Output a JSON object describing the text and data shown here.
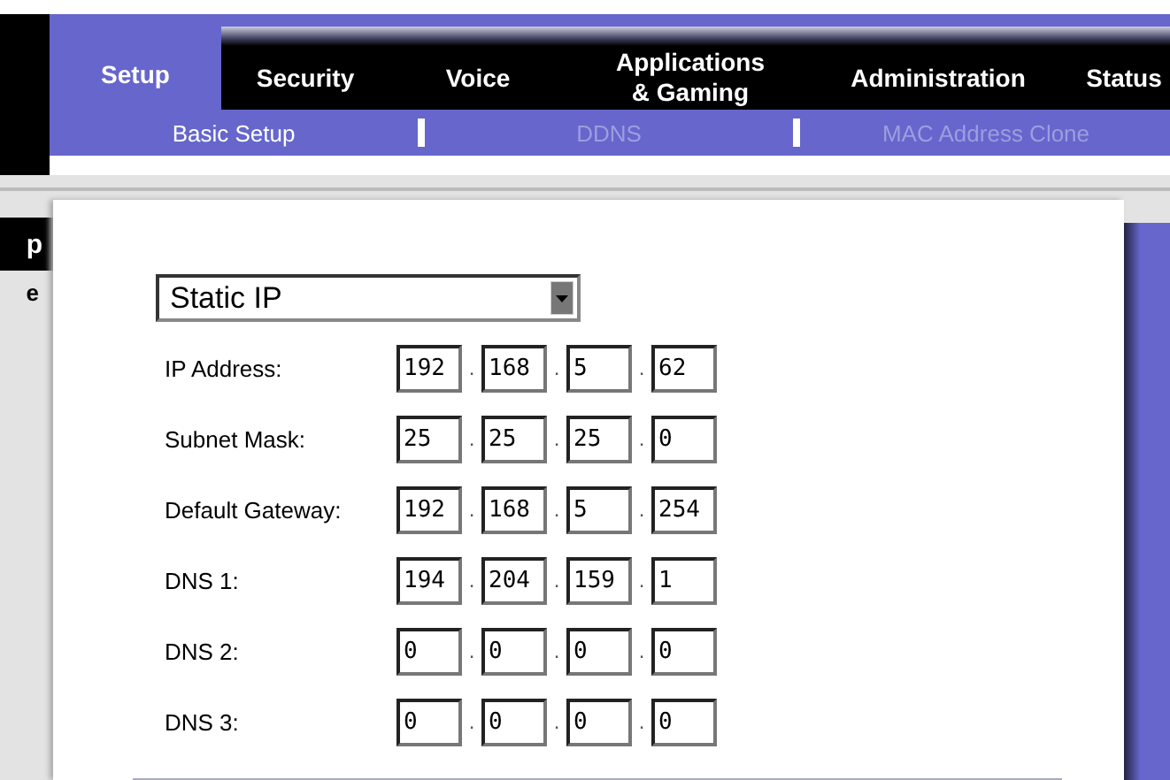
{
  "tabs": [
    {
      "label": "Setup",
      "selected": true
    },
    {
      "label": "Security",
      "selected": false
    },
    {
      "label": "Voice",
      "selected": false
    },
    {
      "label": "Applications\n& Gaming",
      "selected": false
    },
    {
      "label": "Administration",
      "selected": false
    },
    {
      "label": "Status",
      "selected": false
    }
  ],
  "subtabs": [
    {
      "label": "Basic Setup",
      "selected": true
    },
    {
      "label": "DDNS",
      "selected": false
    },
    {
      "label": "MAC Address Clone",
      "selected": false
    }
  ],
  "side": {
    "heading": "p",
    "label": "e"
  },
  "connection_type": {
    "value": "Static IP"
  },
  "fields": [
    {
      "label": "IP Address:",
      "octets": [
        "192",
        "168",
        "5",
        "62"
      ],
      "separators": [
        ".",
        ".",
        "."
      ]
    },
    {
      "label": "Subnet Mask:",
      "octets": [
        "25",
        "25",
        "25",
        "0"
      ],
      "separators": [
        ".",
        ".",
        "."
      ]
    },
    {
      "label": "Default Gateway:",
      "octets": [
        "192",
        "168",
        "5",
        "254"
      ],
      "separators": [
        ".",
        ".",
        "."
      ]
    },
    {
      "label": "DNS 1:",
      "octets": [
        "194",
        "204",
        "159",
        "1"
      ],
      "separators": [
        ".",
        ".",
        "."
      ]
    },
    {
      "label": "DNS 2:",
      "octets": [
        "0",
        "0",
        "0",
        "0"
      ],
      "separators": [
        ".",
        ".",
        "."
      ]
    },
    {
      "label": "DNS 3:",
      "octets": [
        "0",
        "0",
        "0",
        "0"
      ],
      "separators": [
        ".",
        ".",
        "."
      ]
    }
  ]
}
